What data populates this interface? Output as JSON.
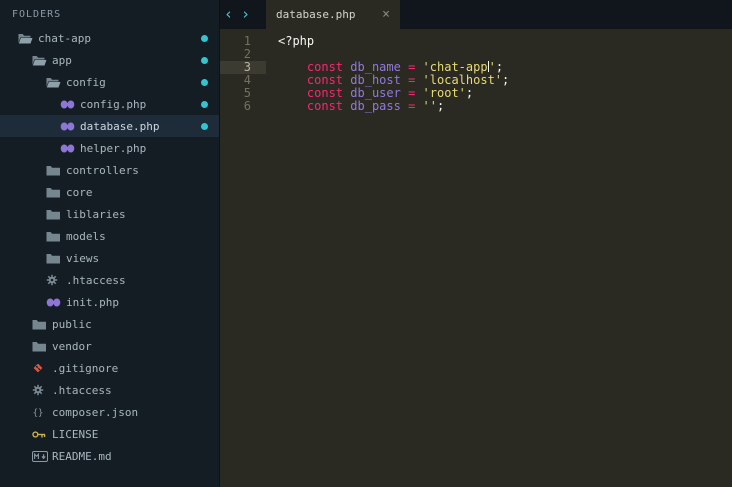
{
  "window": {
    "title": "database.php"
  },
  "sidebar": {
    "header": "FOLDERS",
    "items": [
      {
        "label": "chat-app",
        "icon": "folder-open",
        "indent": 0,
        "modified": true
      },
      {
        "label": "app",
        "icon": "folder-open",
        "indent": 1,
        "modified": true
      },
      {
        "label": "config",
        "icon": "folder-open",
        "indent": 2,
        "modified": true
      },
      {
        "label": "config.php",
        "icon": "php",
        "indent": 3,
        "modified": true
      },
      {
        "label": "database.php",
        "icon": "php",
        "indent": 3,
        "modified": true,
        "selected": true
      },
      {
        "label": "helper.php",
        "icon": "php",
        "indent": 3
      },
      {
        "label": "controllers",
        "icon": "folder",
        "indent": 2
      },
      {
        "label": "core",
        "icon": "folder",
        "indent": 2
      },
      {
        "label": "liblaries",
        "icon": "folder",
        "indent": 2
      },
      {
        "label": "models",
        "icon": "folder",
        "indent": 2
      },
      {
        "label": "views",
        "icon": "folder",
        "indent": 2
      },
      {
        "label": ".htaccess",
        "icon": "gear",
        "indent": 2
      },
      {
        "label": "init.php",
        "icon": "php",
        "indent": 2
      },
      {
        "label": "public",
        "icon": "folder",
        "indent": 1
      },
      {
        "label": "vendor",
        "icon": "folder",
        "indent": 1
      },
      {
        "label": ".gitignore",
        "icon": "git",
        "indent": 1
      },
      {
        "label": ".htaccess",
        "icon": "gear",
        "indent": 1
      },
      {
        "label": "composer.json",
        "icon": "json",
        "indent": 1
      },
      {
        "label": "LICENSE",
        "icon": "license",
        "indent": 1
      },
      {
        "label": "README.md",
        "icon": "markdown",
        "indent": 1
      }
    ]
  },
  "tabbar": {
    "prev": "‹",
    "next": "›",
    "tabs": [
      {
        "label": "database.php",
        "close": "×",
        "active": true
      }
    ]
  },
  "editor": {
    "language": "php",
    "lines": [
      {
        "num": "1",
        "tokens": [
          [
            "p",
            "<?php"
          ]
        ]
      },
      {
        "num": "2",
        "tokens": []
      },
      {
        "num": "3",
        "current": true,
        "tokens": [
          [
            "p",
            "    "
          ],
          [
            "k",
            "const"
          ],
          [
            "p",
            " "
          ],
          [
            "n",
            "db_name"
          ],
          [
            "p",
            " "
          ],
          [
            "k",
            "="
          ],
          [
            "p",
            " "
          ],
          [
            "s",
            "'chat-app"
          ],
          [
            "cursor",
            ""
          ],
          [
            "s",
            "'"
          ],
          [
            "p",
            ";"
          ]
        ]
      },
      {
        "num": "4",
        "tokens": [
          [
            "p",
            "    "
          ],
          [
            "k",
            "const"
          ],
          [
            "p",
            " "
          ],
          [
            "n",
            "db_host"
          ],
          [
            "p",
            " "
          ],
          [
            "k",
            "="
          ],
          [
            "p",
            " "
          ],
          [
            "s",
            "'localhost'"
          ],
          [
            "p",
            ";"
          ]
        ]
      },
      {
        "num": "5",
        "tokens": [
          [
            "p",
            "    "
          ],
          [
            "k",
            "const"
          ],
          [
            "p",
            " "
          ],
          [
            "n",
            "db_user"
          ],
          [
            "p",
            " "
          ],
          [
            "k",
            "="
          ],
          [
            "p",
            " "
          ],
          [
            "s",
            "'root'"
          ],
          [
            "p",
            ";"
          ]
        ]
      },
      {
        "num": "6",
        "tokens": [
          [
            "p",
            "    "
          ],
          [
            "k",
            "const"
          ],
          [
            "p",
            " "
          ],
          [
            "n",
            "db_pass"
          ],
          [
            "p",
            " "
          ],
          [
            "k",
            "="
          ],
          [
            "p",
            " "
          ],
          [
            "s",
            "''"
          ],
          [
            "p",
            ";"
          ]
        ]
      }
    ]
  },
  "colors": {
    "sidebar_bg": "#151d24",
    "selected_row_bg": "#1e2c39",
    "editor_bg": "#2a2a23",
    "tabbar_bg": "#10161c",
    "accent_teal": "#35c3d2",
    "keyword": "#f92672",
    "string": "#e6db74",
    "identifier": "#9179d9",
    "plain_text": "#f8f8f2"
  }
}
